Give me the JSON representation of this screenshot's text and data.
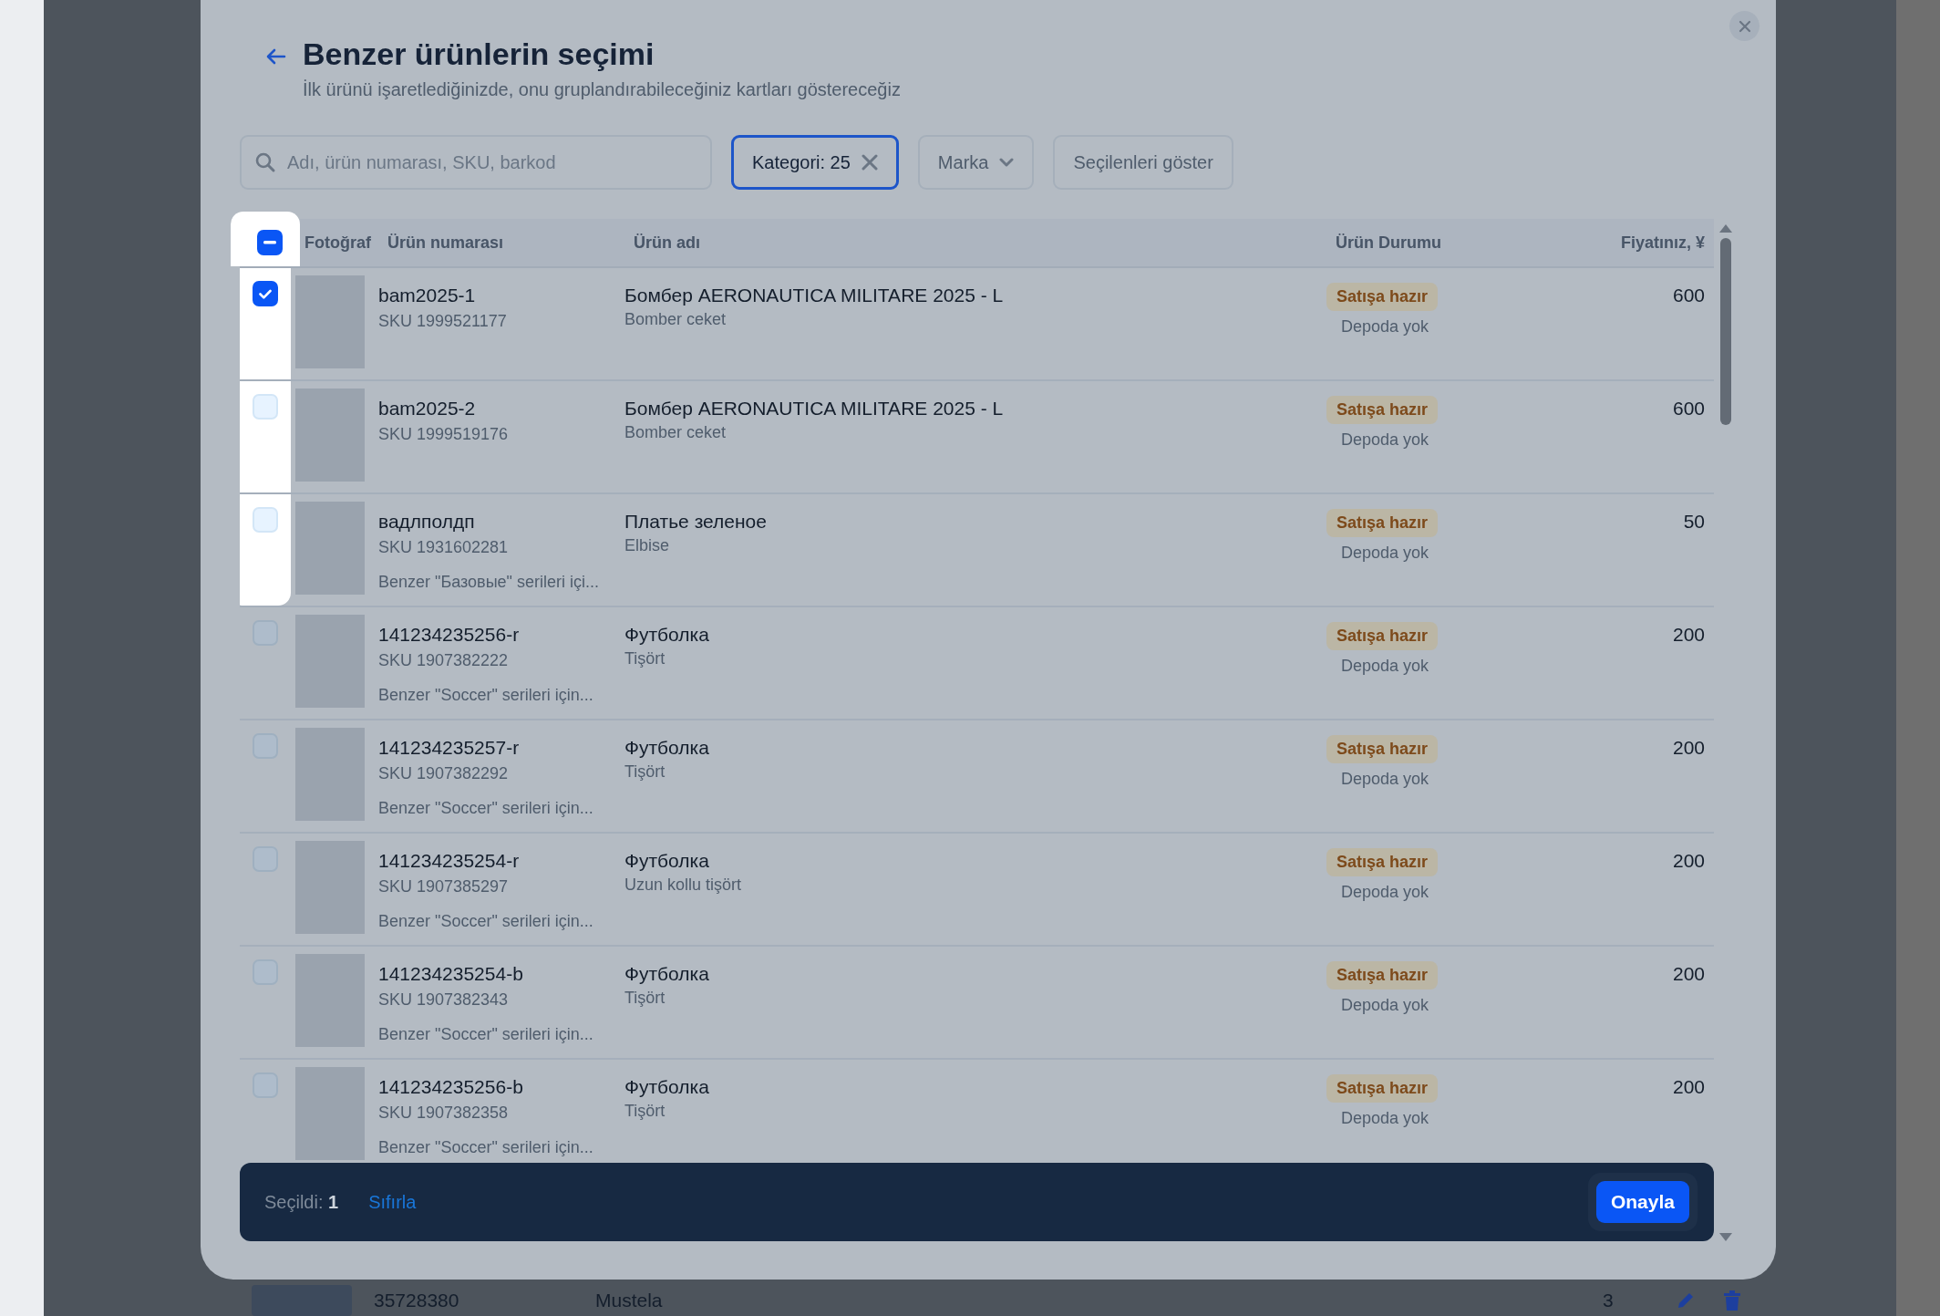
{
  "dialog": {
    "title": "Benzer ürünlerin seçimi",
    "subtitle": "İlk ürünü işaretlediğinizde, onu gruplandırabileceğiniz kartları göstereceğiz"
  },
  "filters": {
    "search": {
      "placeholder": "Adı, ürün numarası, SKU, barkod"
    },
    "category_chip": {
      "label": "Kategori: 25",
      "selected": true
    },
    "brand_dropdown": {
      "label": "Marka"
    },
    "show_selected_button": {
      "label": "Seçilenleri göster"
    }
  },
  "table": {
    "select_all": {
      "checked": true,
      "indeterminate": true,
      "highlighted": true
    },
    "columns": [
      "Fotoğraf",
      "Ürün numarası",
      "Ürün adı",
      "Ürün Durumu",
      "Fiyatınız, ¥"
    ],
    "rows": [
      {
        "checked": true,
        "highlighted": true,
        "number": "bam2025-1",
        "sku": "SKU 1999521177",
        "name": "Бомбер AERONAUTICA MILITARE 2025 - L",
        "category": "Bomber ceket",
        "status": "Satışa hazır",
        "stock": "Depoda yok",
        "price": "600"
      },
      {
        "checked": false,
        "highlighted": true,
        "number": "bam2025-2",
        "sku": "SKU 1999519176",
        "name": "Бомбер AERONAUTICA MILITARE 2025 - L",
        "category": "Bomber ceket",
        "status": "Satışa hazır",
        "stock": "Depoda yok",
        "price": "600"
      },
      {
        "checked": false,
        "highlighted": true,
        "number": "вадлполдп",
        "sku": "SKU 1931602281",
        "note": "Benzer \"Базовые\" serileri içi...",
        "name": "Платье зеленое",
        "category": "Elbise",
        "status": "Satışa hazır",
        "stock": "Depoda yok",
        "price": "50"
      },
      {
        "checked": false,
        "highlighted": false,
        "number": "141234235256-r",
        "sku": "SKU 1907382222",
        "note": "Benzer \"Soccer\" serileri için...",
        "name": "Футболка",
        "category": "Tişört",
        "status": "Satışa hazır",
        "stock": "Depoda yok",
        "price": "200"
      },
      {
        "checked": false,
        "highlighted": false,
        "number": "141234235257-r",
        "sku": "SKU 1907382292",
        "note": "Benzer \"Soccer\" serileri için...",
        "name": "Футболка",
        "category": "Tişört",
        "status": "Satışa hazır",
        "stock": "Depoda yok",
        "price": "200"
      },
      {
        "checked": false,
        "highlighted": false,
        "number": "141234235254-r",
        "sku": "SKU 1907385297",
        "note": "Benzer \"Soccer\" serileri için...",
        "name": "Футболка",
        "category": "Uzun kollu tişört",
        "status": "Satışa hazır",
        "stock": "Depoda yok",
        "price": "200"
      },
      {
        "checked": false,
        "highlighted": false,
        "number": "141234235254-b",
        "sku": "SKU 1907382343",
        "note": "Benzer \"Soccer\" serileri için...",
        "name": "Футболка",
        "category": "Tişört",
        "status": "Satışa hazır",
        "stock": "Depoda yok",
        "price": "200"
      },
      {
        "checked": false,
        "highlighted": false,
        "number": "141234235256-b",
        "sku": "SKU 1907382358",
        "note": "Benzer \"Soccer\" serileri için...",
        "name": "Футболка",
        "category": "Tişört",
        "status": "Satışa hazır",
        "stock": "Depoda yok",
        "price": "200"
      }
    ]
  },
  "footer": {
    "selected_text": "Seçildi: **1**",
    "reset_link": "Sıfırla",
    "confirm_button": "Onayla"
  },
  "background_row": {
    "number": "35728380",
    "brand": "Mustela",
    "quantity": "3"
  }
}
